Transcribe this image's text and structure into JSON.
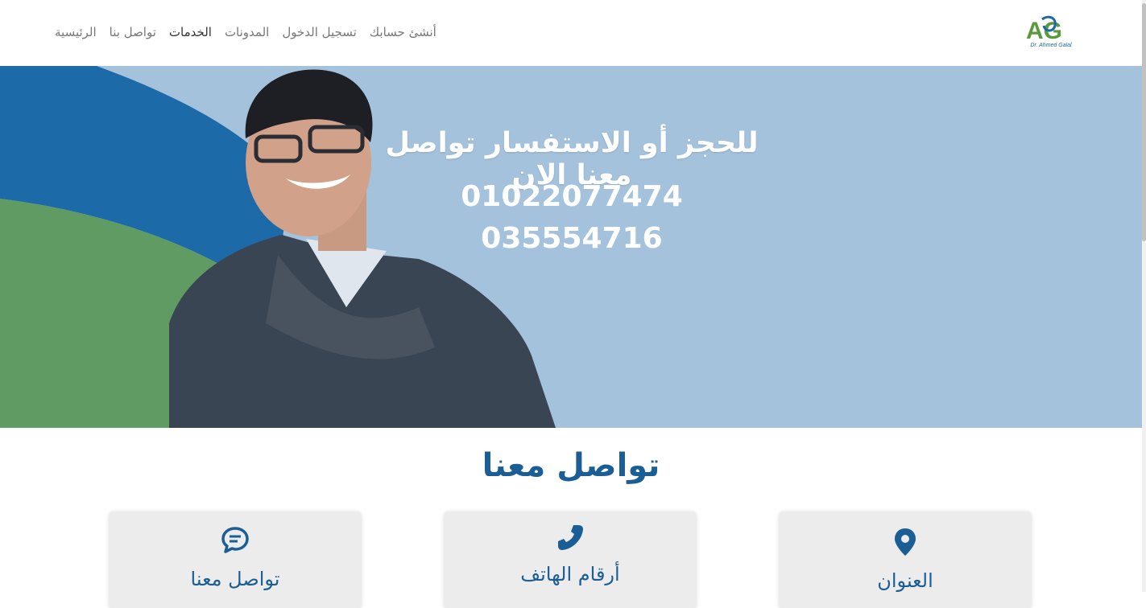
{
  "header": {
    "logo_text": "AG",
    "logo_subtitle": "Dr. Ahmed Galal",
    "nav_items": [
      {
        "label": "الرئيسية"
      },
      {
        "label": "تواصل بنا"
      },
      {
        "label": "الخدمات"
      },
      {
        "label": "المدونات"
      },
      {
        "label": "تسجيل الدخول"
      },
      {
        "label": "أنشئ حسابك"
      }
    ]
  },
  "hero": {
    "title": "للحجز أو الاستفسار تواصل معنا الان",
    "phone_1": "01022077474",
    "phone_2": "035554716"
  },
  "contact": {
    "title": "تواصل معنا",
    "cards": [
      {
        "label": "تواصل معنا",
        "icon": "chat-icon"
      },
      {
        "label": "أرقام الهاتف",
        "icon": "phone-icon"
      },
      {
        "label": "العنوان",
        "icon": "location-pin-icon"
      }
    ]
  },
  "colors": {
    "accent": "#1b5e96",
    "hero_bg": "#a4c2dc",
    "wave_blue": "#1d6aa8",
    "wave_green": "#5f9b62"
  }
}
